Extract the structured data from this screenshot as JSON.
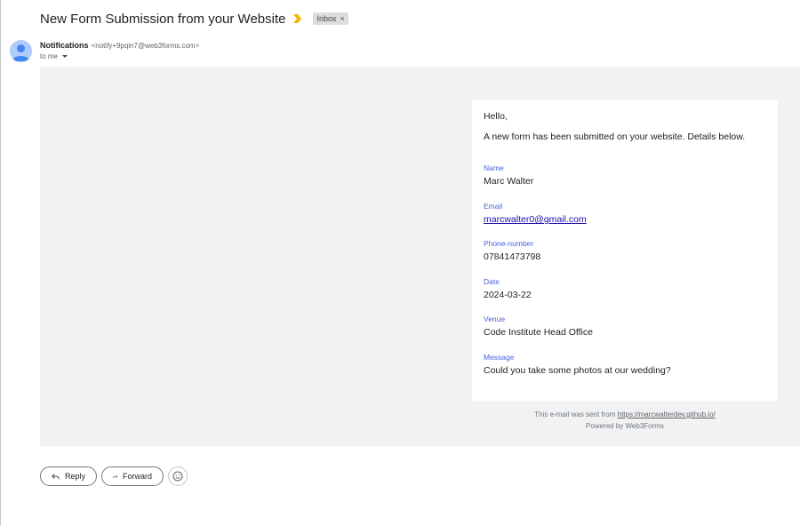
{
  "email": {
    "subject": "New Form Submission from your Website",
    "label": "Inbox",
    "label_close": "×",
    "sender_name": "Notifications",
    "sender_email": "<notify+9pqin7@web3forms.com>",
    "recipient": "to me"
  },
  "card": {
    "greeting": "Hello,",
    "intro": "A new form has been submitted on your website. Details below.",
    "fields": [
      {
        "label": "Name",
        "value": "Marc Walter"
      },
      {
        "label": "Email",
        "value": "marcwalter0@gmail.com"
      },
      {
        "label": "Phone-number",
        "value": "07841473798"
      },
      {
        "label": "Date",
        "value": "2024-03-22"
      },
      {
        "label": "Venue",
        "value": "Code Institute Head Office"
      },
      {
        "label": "Message",
        "value": "Could you take some photos at our wedding?"
      }
    ]
  },
  "footer": {
    "sent_from_prefix": "This e-mail was sent from",
    "sent_from_link": "https://marcwalterdev.github.io/",
    "powered_by": "Powered by Web3Forms"
  },
  "actions": {
    "reply_label": "Reply",
    "forward_label": "Forward"
  },
  "colors": {
    "field_label": "#4a62d8",
    "link": "#1a0dab",
    "importance_marker": "#f4b400",
    "body_background": "#f1f2f3"
  },
  "icons": {
    "importance": "importance-marker-icon",
    "avatar": "person-avatar-icon",
    "reply": "reply-arrow-icon",
    "forward": "forward-arrow-icon",
    "emoji": "emoji-smile-icon"
  }
}
